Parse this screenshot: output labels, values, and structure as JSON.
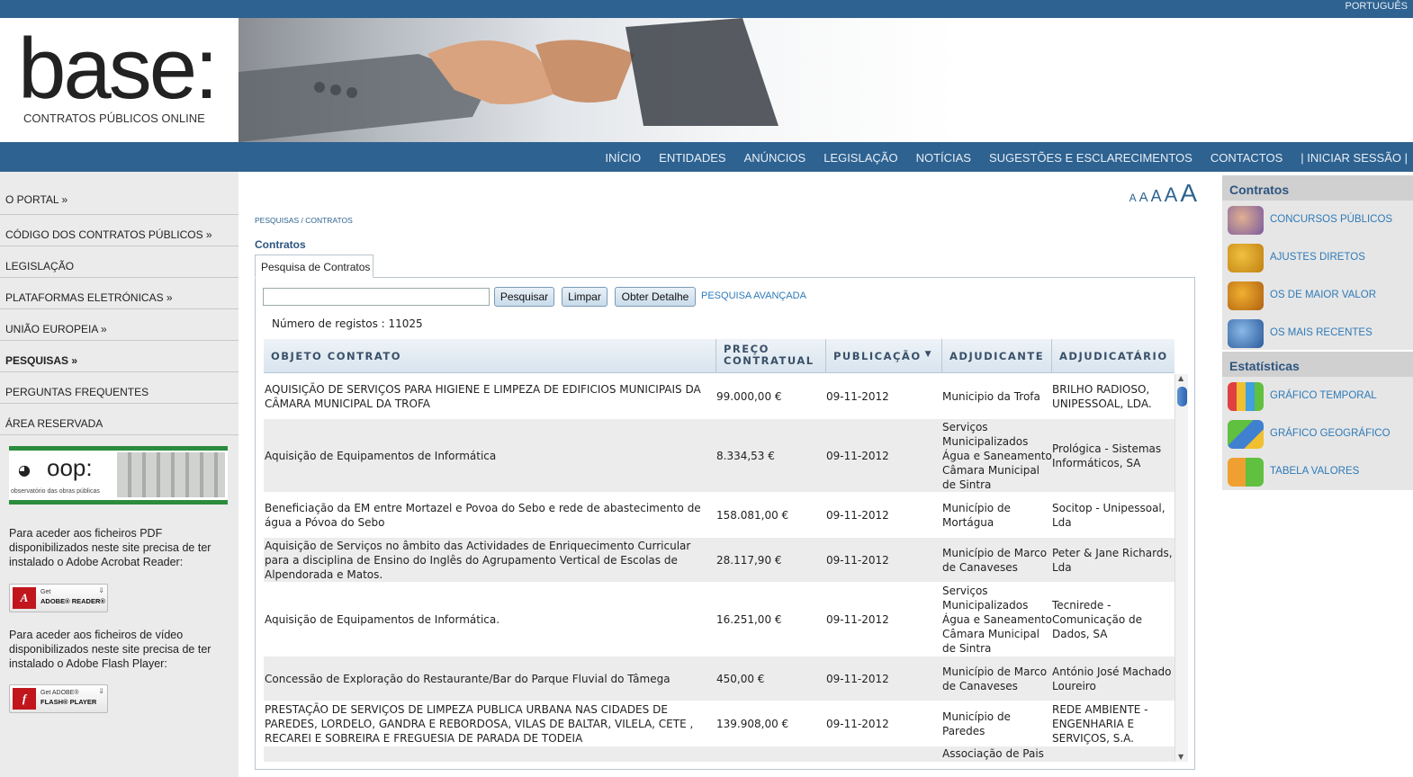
{
  "top": {
    "language": "PORTUGUÊS"
  },
  "logo": {
    "name": "base:",
    "tagline": "CONTRATOS PÚBLICOS ONLINE"
  },
  "nav": [
    "INÍCIO",
    "ENTIDADES",
    "ANÚNCIOS",
    "LEGISLAÇÃO",
    "NOTÍCIAS",
    "SUGESTÕES E ESCLARECIMENTOS",
    "CONTACTOS",
    "| INICIAR SESSÃO |"
  ],
  "sidebar": {
    "items": [
      "O PORTAL »",
      "CÓDIGO DOS CONTRATOS PÚBLICOS »",
      "LEGISLAÇÃO",
      "PLATAFORMAS ELETRÓNICAS »",
      "UNIÃO EUROPEIA »",
      "PESQUISAS »",
      "PERGUNTAS FREQUENTES",
      "ÁREA RESERVADA"
    ],
    "oop_title": "oop:",
    "oop_subtitle": "observatório das obras públicas",
    "pdf_text": "Para aceder aos ficheiros PDF disponibilizados neste site precisa de ter instalado o Adobe Acrobat Reader:",
    "reader_get": "Get",
    "reader_label": "ADOBE® READER®",
    "video_text": "Para aceder aos ficheiros de vídeo disponibilizados neste site precisa de ter instalado o Adobe Flash Player:",
    "flash_get": "Get ADOBE®",
    "flash_label": "FLASH® PLAYER"
  },
  "font_sizes": [
    "A",
    "A",
    "A",
    "A",
    "A"
  ],
  "breadcrumb": "PESQUISAS / CONTRATOS",
  "title": "Contratos",
  "tab": "Pesquisa de Contratos",
  "search": {
    "value": "",
    "buttons": [
      "Pesquisar",
      "Limpar",
      "Obter Detalhe"
    ],
    "advanced": "PESQUISA AVANÇADA"
  },
  "count": "Número de registos : 11025",
  "table": {
    "headers": [
      "OBJETO CONTRATO",
      "PREÇO CONTRATUAL",
      "PUBLICAÇÃO",
      "ADJUDICANTE",
      "ADJUDICATÁRIO"
    ],
    "sort_icon": "sort-desc-icon",
    "rows": [
      [
        "AQUISIÇÃO DE SERVIÇOS PARA HIGIENE E LIMPEZA DE EDIFICIOS MUNICIPAIS DA CÂMARA MUNICIPAL DA TROFA",
        "99.000,00 €",
        "09-11-2012",
        "Municipio da Trofa",
        "BRILHO RADIOSO, UNIPESSOAL, LDA."
      ],
      [
        "Aquisição de Equipamentos de Informática",
        "8.334,53 €",
        "09-11-2012",
        "Serviços Municipalizados Água e Saneamento Câmara Municipal de Sintra",
        "Prológica - Sistemas Informáticos, SA"
      ],
      [
        "Beneficiação da EM entre Mortazel e Povoa do Sebo e rede de abastecimento de água a Póvoa do Sebo",
        "158.081,00 €",
        "09-11-2012",
        "Município de Mortágua",
        "Socitop - Unipessoal, Lda"
      ],
      [
        "Aquisição de Serviços no âmbito das Actividades de Enriquecimento Curricular para a disciplina de Ensino do Inglês do Agrupamento Vertical de Escolas de Alpendorada e Matos.",
        "28.117,90 €",
        "09-11-2012",
        "Município de Marco de Canaveses",
        "Peter & Jane Richards, Lda"
      ],
      [
        "Aquisição de Equipamentos de Informática.",
        "16.251,00 €",
        "09-11-2012",
        "Serviços Municipalizados Água e Saneamento Câmara Municipal de Sintra",
        "Tecnirede - Comunicação de Dados, SA"
      ],
      [
        "Concessão de Exploração do Restaurante/Bar do Parque Fluvial do Tâmega",
        "450,00 €",
        "09-11-2012",
        "Município de Marco de Canaveses",
        "António José Machado Loureiro"
      ],
      [
        "PRESTAÇÃO DE SERVIÇOS DE LIMPEZA PUBLICA URBANA NAS CIDADES DE PAREDES, LORDELO, GANDRA E REBORDOSA, VILAS DE BALTAR, VILELA, CETE , RECAREI E SOBREIRA E FREGUESIA DE PARADA DE TODEIA",
        "139.908,00 €",
        "09-11-2012",
        "Município de Paredes",
        "REDE AMBIENTE - ENGENHARIA E SERVIÇOS, S.A."
      ],
      [
        "",
        "",
        "",
        "Associação de Pais",
        ""
      ]
    ]
  },
  "right": {
    "contratos_title": "Contratos",
    "contratos": [
      {
        "label": "CONCURSOS PÚBLICOS",
        "icon": "pen-hand-icon"
      },
      {
        "label": "AJUSTES DIRETOS",
        "icon": "people-group-icon"
      },
      {
        "label": "OS DE MAIOR VALOR",
        "icon": "dollar-coin-icon"
      },
      {
        "label": "OS MAIS RECENTES",
        "icon": "calendar-icon"
      }
    ],
    "estatisticas_title": "Estatísticas",
    "estatisticas": [
      {
        "label": "GRÁFICO TEMPORAL",
        "icon": "bar-chart-icon"
      },
      {
        "label": "GRÁFICO GEOGRÁFICO",
        "icon": "map-chart-icon"
      },
      {
        "label": "TABELA VALORES",
        "icon": "value-table-icon"
      }
    ]
  },
  "colors": {
    "brand_blue": "#2e6290",
    "link_blue": "#2e7ab8",
    "green": "#2a8c3c"
  }
}
